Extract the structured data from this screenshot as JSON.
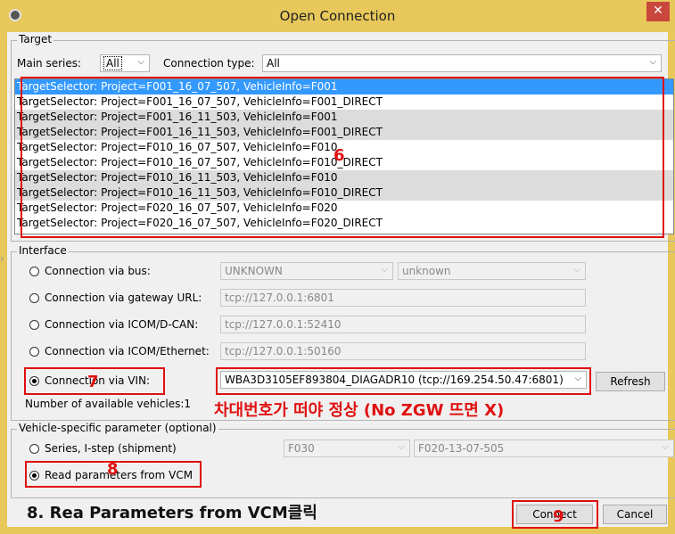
{
  "window": {
    "title": "Open Connection",
    "close_glyph": "✕"
  },
  "target": {
    "legend": "Target",
    "main_series_label": "Main series:",
    "main_series_value": "All",
    "connection_type_label": "Connection type:",
    "connection_type_value": "All",
    "items": [
      "TargetSelector: Project=F001_16_07_507, VehicleInfo=F001",
      "TargetSelector: Project=F001_16_07_507, VehicleInfo=F001_DIRECT",
      "TargetSelector: Project=F001_16_11_503, VehicleInfo=F001",
      "TargetSelector: Project=F001_16_11_503, VehicleInfo=F001_DIRECT",
      "TargetSelector: Project=F010_16_07_507, VehicleInfo=F010",
      "TargetSelector: Project=F010_16_07_507, VehicleInfo=F010_DIRECT",
      "TargetSelector: Project=F010_16_11_503, VehicleInfo=F010",
      "TargetSelector: Project=F010_16_11_503, VehicleInfo=F010_DIRECT",
      "TargetSelector: Project=F020_16_07_507, VehicleInfo=F020",
      "TargetSelector: Project=F020_16_07_507, VehicleInfo=F020_DIRECT"
    ]
  },
  "interface": {
    "legend": "Interface",
    "bus_label": "Connection via bus:",
    "bus_value": "UNKNOWN",
    "bus_value2": "unknown",
    "gateway_label": "Connection via gateway URL:",
    "gateway_value": "tcp://127.0.0.1:6801",
    "dcan_label": "Connection via ICOM/D-CAN:",
    "dcan_value": "tcp://127.0.0.1:52410",
    "ethernet_label": "Connection via ICOM/Ethernet:",
    "ethernet_value": "tcp://127.0.0.1:50160",
    "vin_label": "Connection via VIN:",
    "vin_value": "WBA3D3105EF893804_DIAGADR10 (tcp://169.254.50.47:6801)",
    "refresh_label": "Refresh",
    "available_text": "Number of available vehicles:1"
  },
  "vehicle": {
    "legend": "Vehicle-specific parameter (optional)",
    "series_label": "Series, I-step (shipment)",
    "series_value": "F030",
    "istep_value": "F020-13-07-505",
    "read_label": "Read parameters from VCM"
  },
  "buttons": {
    "connect": "Connect",
    "cancel": "Cancel"
  },
  "annotations": {
    "n6": "6",
    "n7": "7",
    "n8": "8",
    "n9": "9",
    "vin_note": "차대번호가 떠야 정상 (No ZGW 뜨면 X)",
    "caption": "8. Rea Parameters from VCM클릭"
  },
  "colors": {
    "title_bar": "#e8c85a",
    "selection": "#3399ff",
    "annotation_red": "#e01010",
    "close_button": "#c9473c"
  }
}
